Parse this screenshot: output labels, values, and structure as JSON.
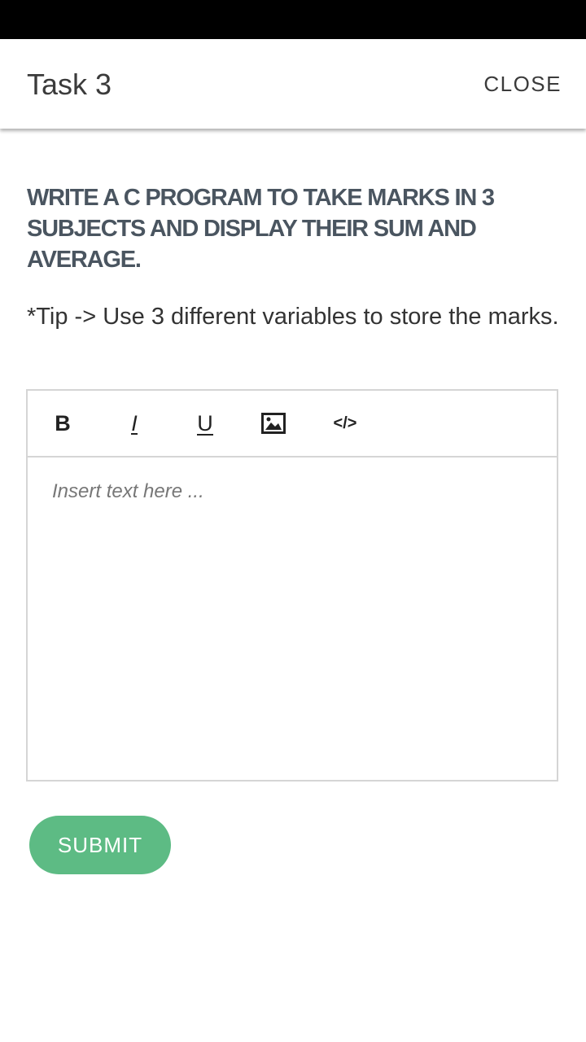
{
  "app_bar": {
    "title": "Task 3",
    "close_label": "CLOSE"
  },
  "question": {
    "text": "WRITE A C PROGRAM TO TAKE MARKS IN 3 SUBJECTS AND DISPLAY THEIR SUM AND AVERAGE.",
    "tip": "*Tip -> Use 3 different variables to store the marks."
  },
  "editor": {
    "toolbar": {
      "bold_label": "B",
      "italic_label": "I",
      "underline_label": "U",
      "image_icon": "image-icon",
      "code_label": "</>"
    },
    "placeholder": "Insert text here ...",
    "value": ""
  },
  "submit": {
    "label": "SUBMIT"
  },
  "colors": {
    "status_bar": "#000000",
    "accent": "#5dbb84",
    "question_text": "#4a5560",
    "border": "#d5d5d5"
  }
}
